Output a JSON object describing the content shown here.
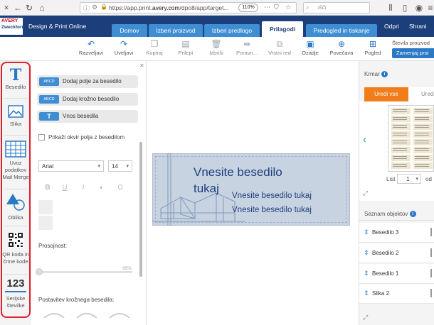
{
  "browser": {
    "url_prefix": "https://app.print.",
    "url_domain": "avery.com",
    "url_suffix": "/dpo8/app/target...",
    "zoom": "110%",
    "search_placeholder": "išči"
  },
  "header": {
    "logo_top": "AVERY",
    "logo_bottom": "Zweckform",
    "title": "Design & Print Online",
    "steps": [
      {
        "label": "Domov"
      },
      {
        "label": "Izberi proizvod"
      },
      {
        "label": "Izberi predlogo"
      },
      {
        "label": "Prilagodi"
      },
      {
        "label": "Predogled in tiskanje"
      }
    ],
    "open": "Odpri",
    "save": "Shrani"
  },
  "toolbar": {
    "tools": [
      {
        "label": "Razveljavi",
        "icon": "undo-icon"
      },
      {
        "label": "Uveljavi",
        "icon": "redo-icon"
      },
      {
        "label": "Kopiraj",
        "icon": "copy-icon"
      },
      {
        "label": "Prilepi",
        "icon": "paste-icon"
      },
      {
        "label": "Izbriši",
        "icon": "trash-icon"
      },
      {
        "label": "Poravn...",
        "icon": "align-icon"
      },
      {
        "label": "Vrstni red",
        "icon": "order-icon"
      },
      {
        "label": "Ozadje",
        "icon": "background-icon"
      },
      {
        "label": "Povečava",
        "icon": "zoom-icon"
      },
      {
        "label": "Pogled",
        "icon": "grid-icon"
      }
    ],
    "layout_label": "Števila proizvod",
    "layout_button": "Zamenjaj proi"
  },
  "sidebar": {
    "items": [
      {
        "label": "Besedilo",
        "icon": "text-icon"
      },
      {
        "label": "Slika",
        "icon": "image-icon"
      },
      {
        "label": "Uvoz podatkov Mail Merge",
        "icon": "table-icon"
      },
      {
        "label": "Oblika",
        "icon": "shape-icon"
      },
      {
        "label": "QR koda in črtne kode",
        "icon": "qr-icon"
      },
      {
        "label": "Serijske številke",
        "icon": "serial-icon",
        "glyph": "123"
      }
    ]
  },
  "panel": {
    "buttons": [
      {
        "label": "Dodaj polje za besedilo",
        "badge": "ABCD"
      },
      {
        "label": "Dodaj krožno besedilo",
        "badge": "ABCD"
      },
      {
        "label": "Vnos besedila",
        "badge": "T"
      }
    ],
    "checkbox_label": "Prikaži okvir polja z besedilom",
    "font": "Arial",
    "font_size": "14",
    "opacity_label": "Prosojnost:",
    "opacity_value": 95,
    "opacity_text": "95%",
    "curve_label": "Postavitev krožnega besedila:"
  },
  "canvas": {
    "title_line1": "Vnesite besedilo",
    "title_line2": "tukaj",
    "line_a": "Vnesite besedilo tukaj",
    "line_b": "Vnesite besedilo tukaj"
  },
  "right": {
    "navigator": "Krmar",
    "tab_all": "Uredi vse",
    "tab_one": "Uredi",
    "page_label": "List",
    "page_value": "1",
    "of_label": "od",
    "objects_title": "Seznam objektov",
    "objects": [
      {
        "name": "Besedilo 3"
      },
      {
        "name": "Besedilo 2"
      },
      {
        "name": "Besedilo 1"
      },
      {
        "name": "Slika 2"
      }
    ]
  },
  "colors": {
    "header": "#1c3e7a",
    "tab": "#3f8ed4",
    "accent": "#2b78c5",
    "orange": "#f07c1a",
    "highlight": "#e0202a"
  }
}
